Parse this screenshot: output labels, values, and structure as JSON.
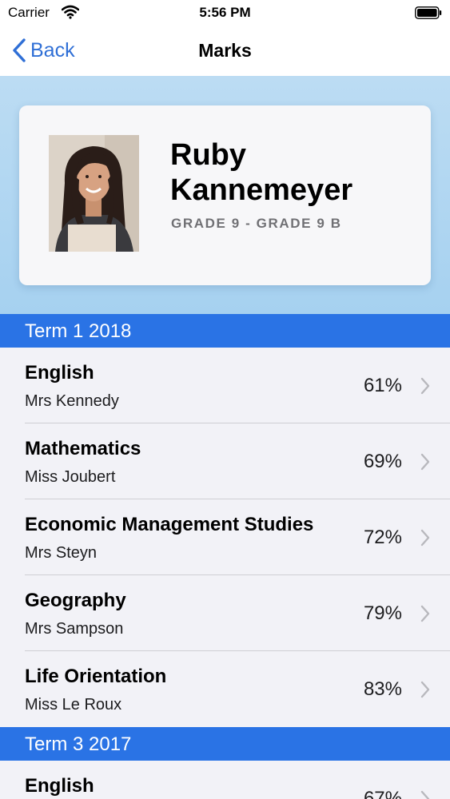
{
  "status_bar": {
    "carrier": "Carrier",
    "time": "5:56 PM",
    "icons": [
      "wifi-icon",
      "battery-icon"
    ]
  },
  "nav": {
    "back_label": "Back",
    "title": "Marks"
  },
  "profile": {
    "name": "Ruby Kannemeyer",
    "grade": "GRADE 9 - GRADE 9 B"
  },
  "colors": {
    "accent": "#2f6fd6",
    "section": "#2a73e5",
    "header_bg": "#a6d1f0"
  },
  "sections": [
    {
      "title": "Term 1 2018",
      "rows": [
        {
          "subject": "English",
          "teacher": "Mrs Kennedy",
          "mark": "61%"
        },
        {
          "subject": "Mathematics",
          "teacher": "Miss Joubert",
          "mark": "69%"
        },
        {
          "subject": "Economic Management Studies",
          "teacher": "Mrs Steyn",
          "mark": "72%"
        },
        {
          "subject": "Geography",
          "teacher": "Mrs Sampson",
          "mark": "79%"
        },
        {
          "subject": "Life Orientation",
          "teacher": "Miss Le Roux",
          "mark": "83%"
        }
      ]
    },
    {
      "title": "Term 3 2017",
      "rows": [
        {
          "subject": "English",
          "teacher": "",
          "mark": "67%"
        }
      ]
    }
  ]
}
